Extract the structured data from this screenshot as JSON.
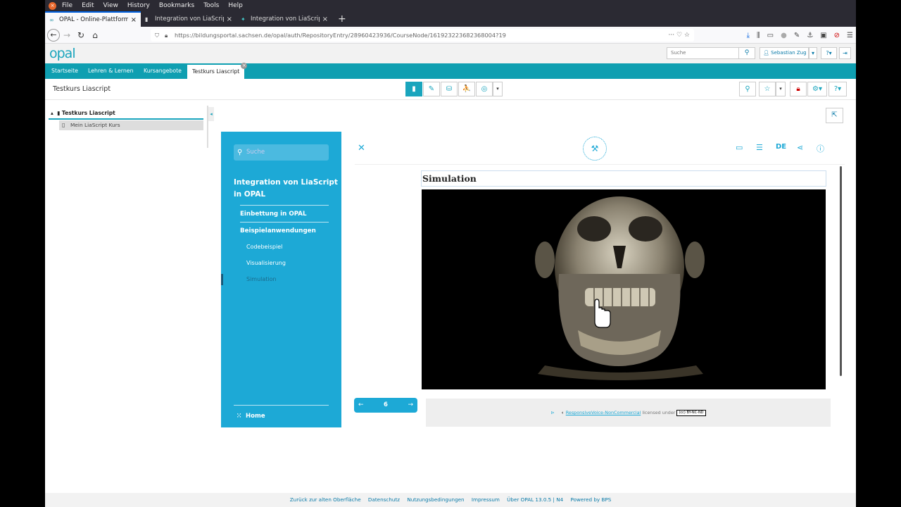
{
  "menu": [
    "File",
    "Edit",
    "View",
    "History",
    "Bookmarks",
    "Tools",
    "Help"
  ],
  "browser_tabs": [
    {
      "title": "OPAL - Online-Plattform für A",
      "icon": "opal-icon"
    },
    {
      "title": "Integration von LiaScript in O",
      "icon": "document-icon"
    },
    {
      "title": "Integration von LiaScript in O",
      "icon": "liascript-icon"
    }
  ],
  "url": "https://bildungsportal.sachsen.de/opal/auth/RepositoryEntry/28960423936/CourseNode/161923223682368004?19",
  "opal": {
    "logo": "opal",
    "search_placeholder": "Suche",
    "user": "Sebastian Zug",
    "nav": [
      "Startseite",
      "Lehren & Lernen",
      "Kursangebote",
      "Testkurs Liascript"
    ],
    "course_title": "Testkurs Liascript"
  },
  "tree": {
    "root": "Testkurs Liascript",
    "child": "Mein LiaScript Kurs"
  },
  "lia": {
    "search_placeholder": "Suche",
    "title": "Integration von LiaScript in OPAL",
    "nav": [
      "Einbettung in OPAL",
      "Beispielanwendungen"
    ],
    "sub": [
      "Codebeispiel",
      "Visualisierung",
      "Simulation"
    ],
    "home": "Home",
    "lang": "DE",
    "section_title": "Simulation",
    "page": "6",
    "footer_link": "ResponsiveVoice-NonCommercial",
    "footer_text": "licensed under",
    "license": "BY-NC-ND"
  },
  "footer": [
    "Zurück zur alten Oberfläche",
    "Datenschutz",
    "Nutzungsbedingungen",
    "Impressum",
    "Über OPAL 13.0.5 | N4",
    "Powered by BPS"
  ],
  "colors": {
    "opal_teal": "#0f9fb1",
    "lia_blue": "#1da9d6"
  }
}
